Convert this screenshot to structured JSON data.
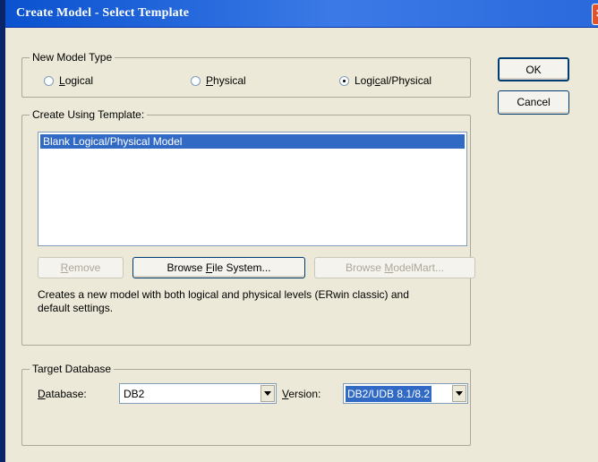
{
  "window": {
    "title": "Create Model - Select Template",
    "close_glyph": "✕"
  },
  "model_type": {
    "legend": "New Model Type",
    "options": [
      {
        "pre": "",
        "accel": "L",
        "post": "ogical",
        "checked": false
      },
      {
        "pre": "",
        "accel": "P",
        "post": "hysical",
        "checked": false
      },
      {
        "pre": "Logi",
        "accel": "c",
        "post": "al/Physical",
        "checked": true
      }
    ]
  },
  "buttons": {
    "ok": "OK",
    "cancel": "Cancel"
  },
  "template": {
    "legend": "Create Using Template:",
    "items": [
      "Blank Logical/Physical Model"
    ],
    "remove": {
      "accel": "R",
      "rest": "emove"
    },
    "browse_file": {
      "pre": "Browse ",
      "accel": "F",
      "post": "ile System..."
    },
    "browse_modelmart": {
      "pre": "Browse ",
      "accel": "M",
      "post": "odelMart..."
    },
    "description_line1": "Creates a new model with both logical and physical levels (ERwin classic) and",
    "description_line2": "default settings."
  },
  "target_db": {
    "legend": "Target Database",
    "database_label": {
      "accel": "D",
      "rest": "atabase:"
    },
    "database_value": "DB2",
    "version_label": {
      "accel": "V",
      "rest": "ersion:"
    },
    "version_value": "DB2/UDB 8.1/8.2"
  },
  "colors": {
    "title_bar": "#0a52cf",
    "selection": "#316ac5",
    "dialog_bg": "#ece9d8"
  }
}
